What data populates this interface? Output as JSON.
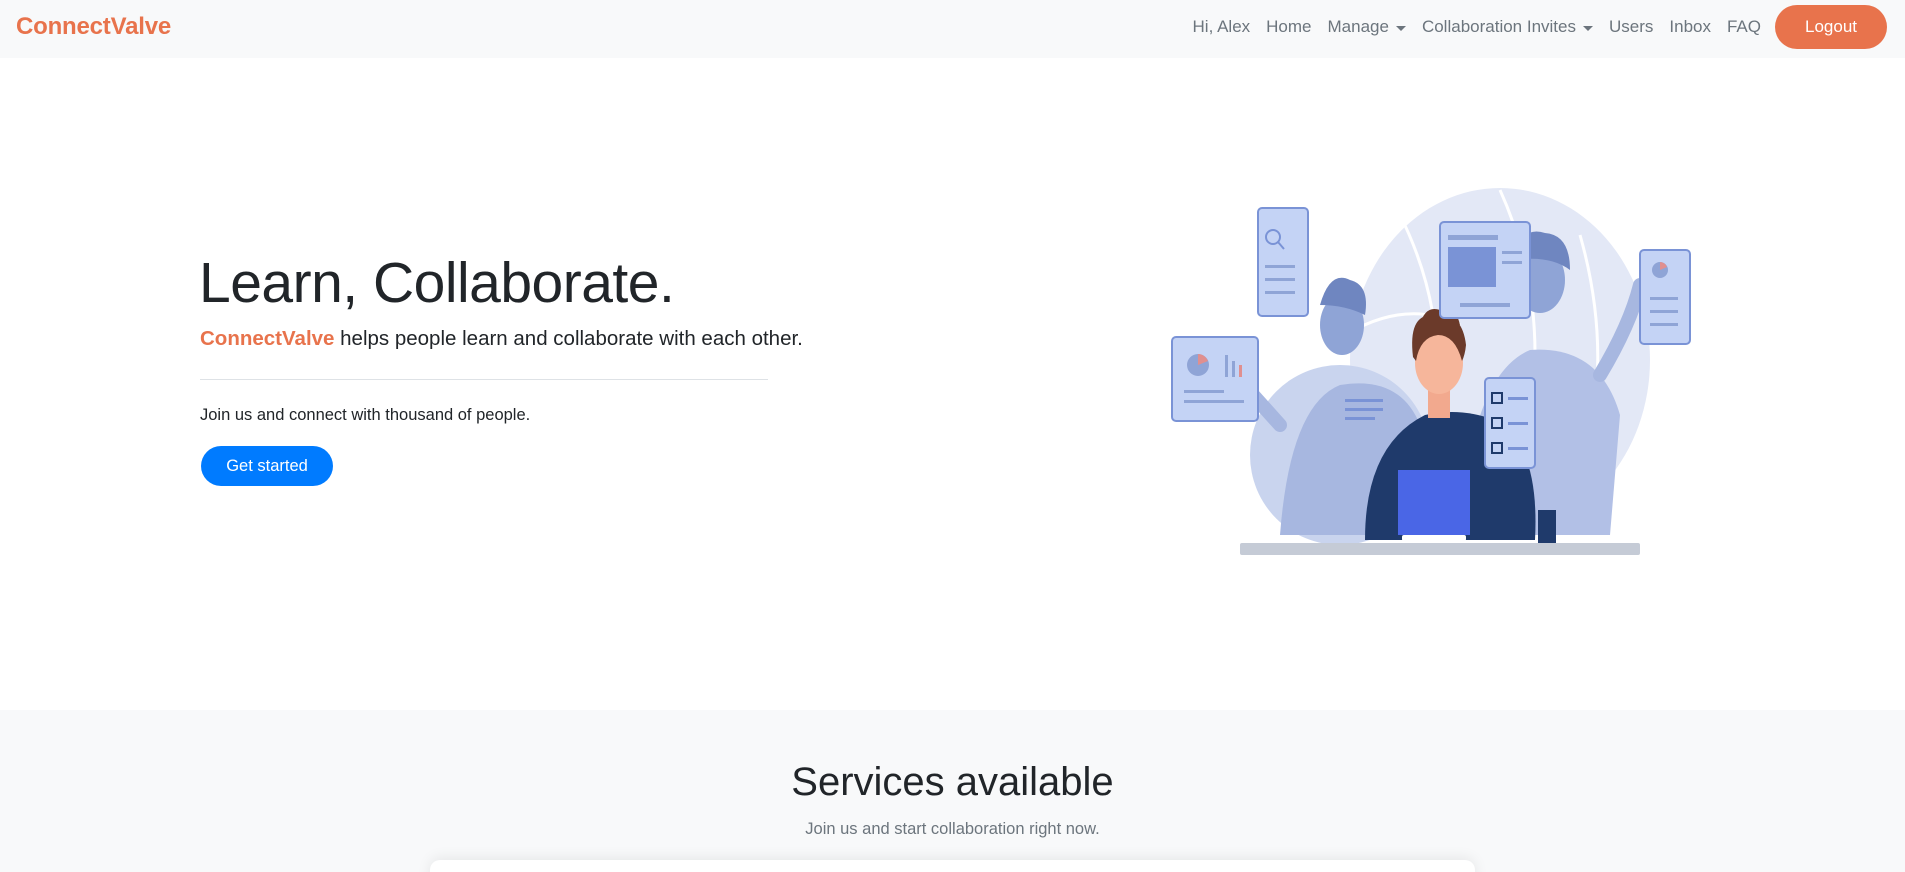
{
  "navbar": {
    "brand": "ConnectValve",
    "greeting": "Hi, Alex",
    "links": {
      "home": "Home",
      "manage": "Manage",
      "collaboration_invites": "Collaboration Invites",
      "users": "Users",
      "inbox": "Inbox",
      "faq": "FAQ"
    },
    "logout_label": "Logout"
  },
  "hero": {
    "title": "Learn, Collaborate.",
    "lead_brand": "ConnectValve",
    "lead_text": " helps people learn and collaborate with each other.",
    "text": "Join us and connect with thousand of people.",
    "cta_label": "Get started"
  },
  "services": {
    "title": "Services available",
    "subtitle": "Join us and start collaboration right now."
  },
  "colors": {
    "brand": "#e8734c",
    "primary_button": "#007bff",
    "navbar_bg": "#f8f9fa"
  },
  "icons": [
    "caret-down-icon",
    "collaboration-illustration"
  ]
}
